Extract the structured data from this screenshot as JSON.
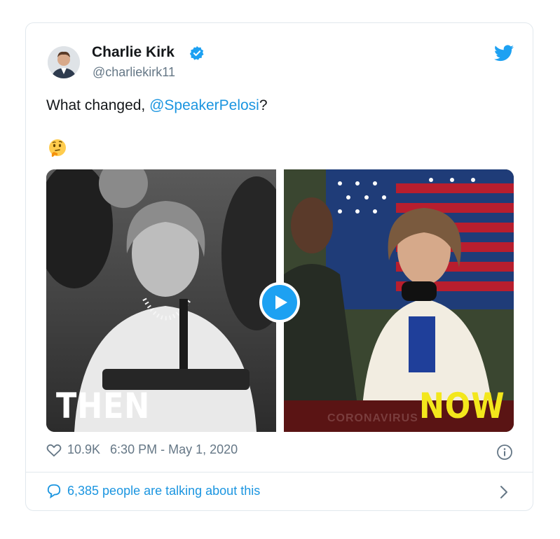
{
  "tweet": {
    "author_name": "Charlie Kirk",
    "handle": "@charliekirk11",
    "text_prefix": "What changed, ",
    "mention": "@SpeakerPelosi",
    "text_suffix": "?",
    "emoji": "🤔"
  },
  "media": {
    "left_label": "THEN",
    "right_label": "NOW",
    "banner_text": "CORONAVIRUS"
  },
  "footer": {
    "likes": "10.9K",
    "timestamp": "6:30 PM - May 1, 2020",
    "talking": "6,385 people are talking about this"
  },
  "icons": {
    "verified": "verified-badge-icon",
    "twitter": "twitter-bird-icon",
    "heart": "heart-icon",
    "info": "info-icon",
    "comment": "speech-bubble-icon",
    "chevron": "chevron-right-icon",
    "play": "play-icon"
  },
  "colors": {
    "accent": "#1da1f2",
    "link": "#1b95e0",
    "muted": "#657786",
    "now_label": "#f3e71c"
  }
}
